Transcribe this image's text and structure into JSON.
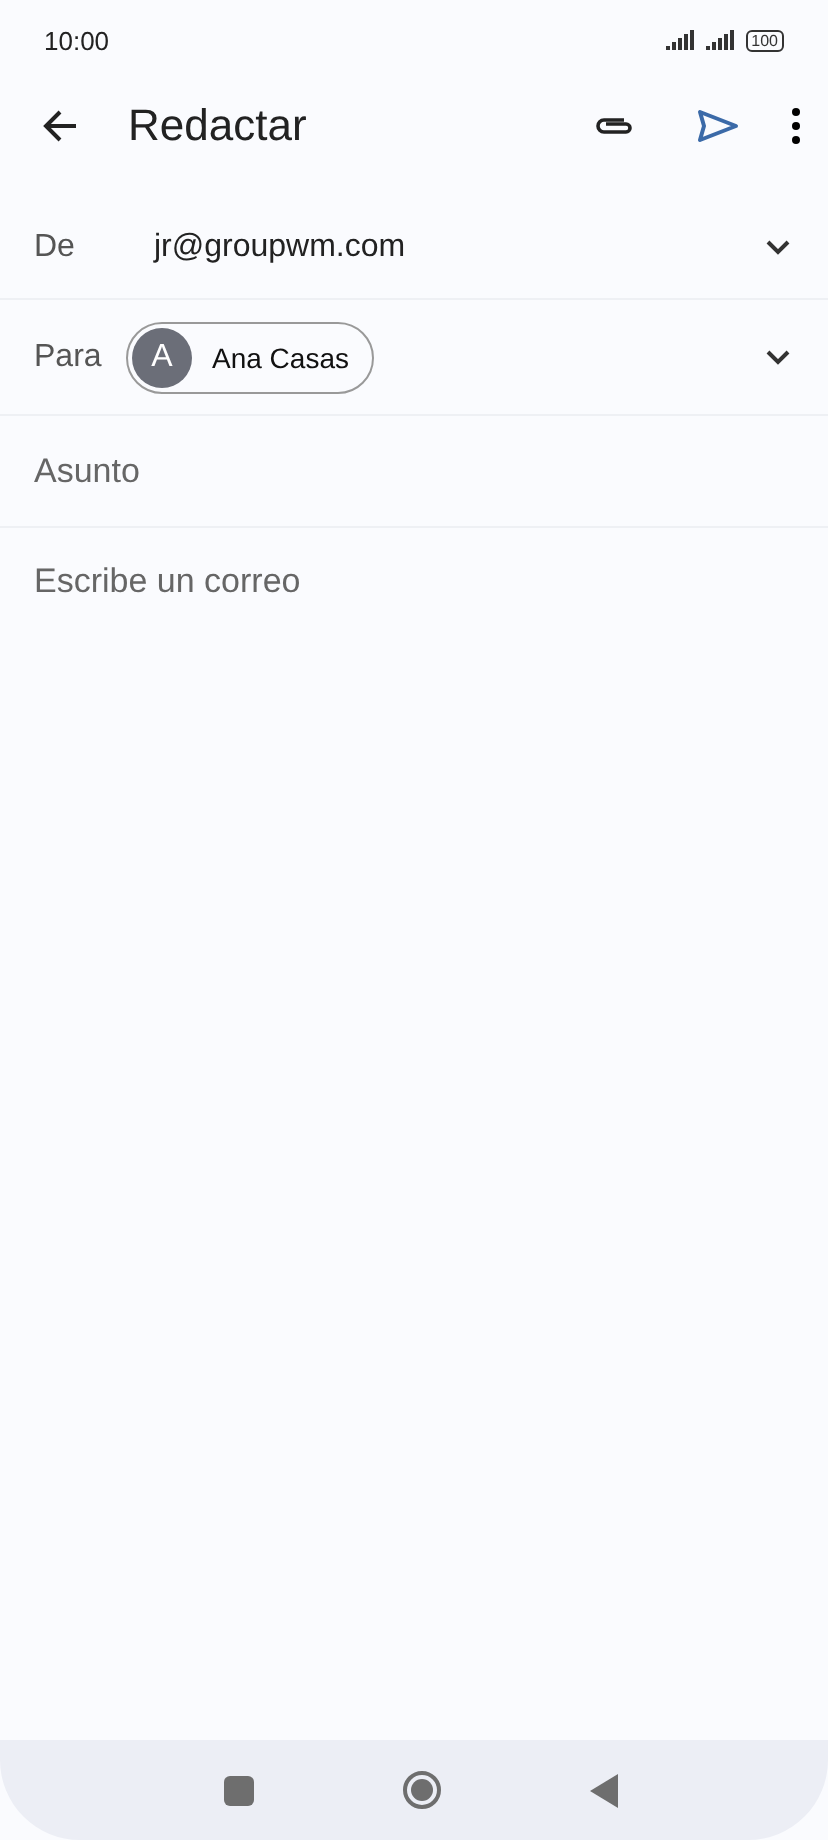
{
  "status_bar": {
    "time": "10:00",
    "battery": "100"
  },
  "app_bar": {
    "title": "Redactar"
  },
  "from": {
    "label": "De",
    "value": "jr@groupwm.com"
  },
  "to": {
    "label": "Para",
    "recipients": [
      {
        "initial": "A",
        "name": "Ana Casas"
      }
    ]
  },
  "subject": {
    "placeholder": "Asunto"
  },
  "body": {
    "placeholder": "Escribe un correo"
  }
}
